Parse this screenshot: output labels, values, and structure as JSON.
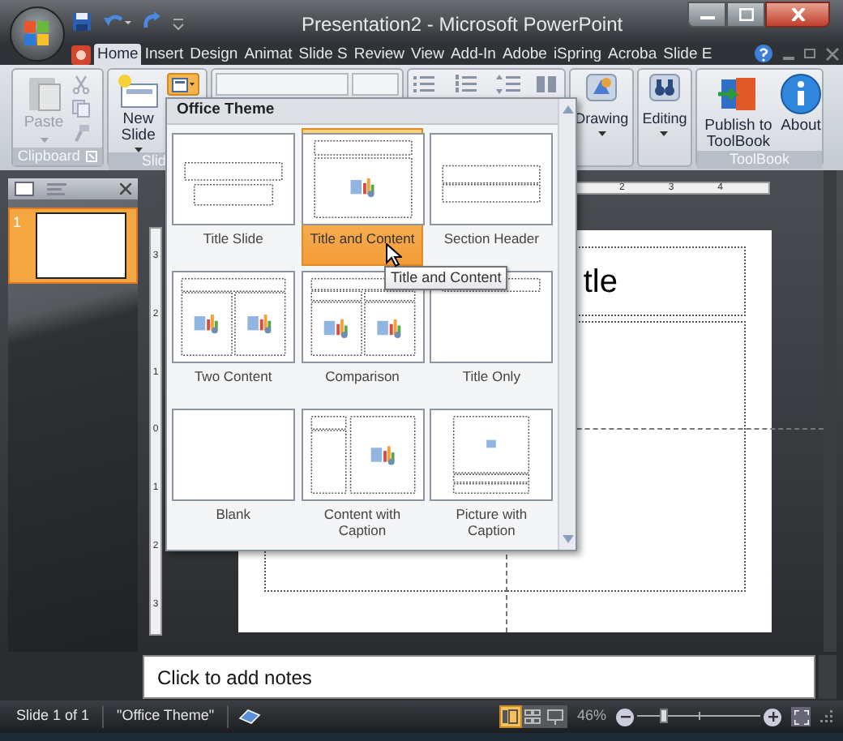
{
  "window": {
    "title": "Presentation2 - Microsoft PowerPoint"
  },
  "tabs": [
    {
      "label": "Home",
      "selected": true
    },
    {
      "label": "Insert",
      "selected": false
    },
    {
      "label": "Design",
      "selected": false
    },
    {
      "label": "Animat",
      "selected": false
    },
    {
      "label": "Slide S",
      "selected": false
    },
    {
      "label": "Review",
      "selected": false
    },
    {
      "label": "View",
      "selected": false
    },
    {
      "label": "Add-In",
      "selected": false
    },
    {
      "label": "Adobe",
      "selected": false
    },
    {
      "label": "iSpring",
      "selected": false
    },
    {
      "label": "Acroba",
      "selected": false
    },
    {
      "label": "Slide E",
      "selected": false
    }
  ],
  "ribbon": {
    "clipboard": {
      "label": "Clipboard",
      "paste": {
        "label": "Paste",
        "disabled": true
      }
    },
    "slides": {
      "label": "Slid",
      "new_slide": "New Slide",
      "layout_open": true
    },
    "drawing": "Drawing",
    "editing": "Editing",
    "toolbook": {
      "label": "ToolBook",
      "buttons": [
        {
          "label": "Publish to ToolBook",
          "kind": "publish"
        },
        {
          "label": "About",
          "kind": "about"
        }
      ]
    }
  },
  "layout_gallery": {
    "title": "Office Theme",
    "tooltip": "Title and Content",
    "layouts": [
      {
        "label": "Title Slide",
        "kind": "title_slide",
        "selected": false
      },
      {
        "label": "Title and Content",
        "kind": "title_content",
        "selected": true
      },
      {
        "label": "Section Header",
        "kind": "section_header",
        "selected": false
      },
      {
        "label": "Two Content",
        "kind": "two_content",
        "selected": false
      },
      {
        "label": "Comparison",
        "kind": "comparison",
        "selected": false
      },
      {
        "label": "Title Only",
        "kind": "title_only",
        "selected": false
      },
      {
        "label": "Blank",
        "kind": "blank",
        "selected": false
      },
      {
        "label": "Content with Caption",
        "kind": "content_caption",
        "selected": false
      },
      {
        "label": "Picture with Caption",
        "kind": "picture_caption",
        "selected": false
      }
    ]
  },
  "slide_panel": {
    "slides": [
      {
        "number": "1",
        "selected": true
      }
    ]
  },
  "rulers": {
    "horizontal": [
      "2",
      "3",
      "4"
    ],
    "vertical": [
      "3",
      "2",
      "1",
      "0",
      "1",
      "2",
      "3"
    ]
  },
  "slide": {
    "title_fragment": "tle"
  },
  "notes": {
    "text": "Click to add notes"
  },
  "status_bar": {
    "slide_info": "Slide 1 of 1",
    "theme": "\"Office Theme\"",
    "zoom": "46%",
    "zoom_slider": {
      "level": 0.2
    },
    "views": [
      {
        "kind": "normal",
        "selected": true
      },
      {
        "kind": "sorter",
        "selected": false
      },
      {
        "kind": "show",
        "selected": false
      }
    ]
  }
}
